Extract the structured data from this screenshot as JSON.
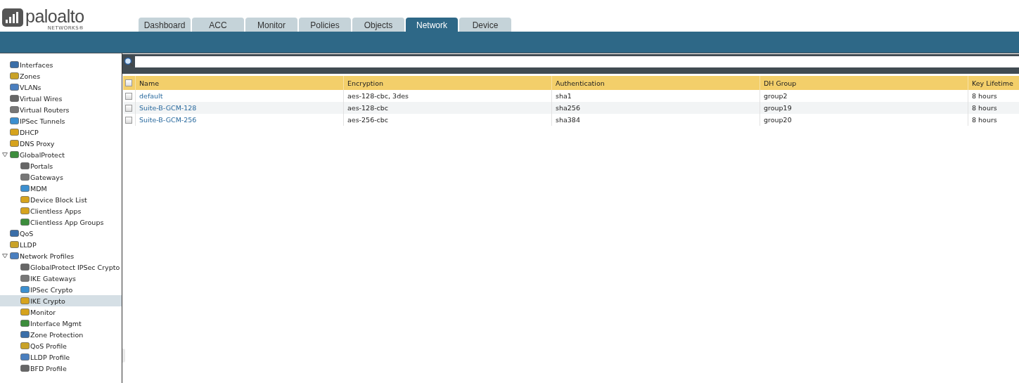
{
  "logo": {
    "name": "paloalto",
    "sub": "NETWORKS®"
  },
  "tabs": [
    {
      "label": "Dashboard",
      "selected": false
    },
    {
      "label": "ACC",
      "selected": false
    },
    {
      "label": "Monitor",
      "selected": false
    },
    {
      "label": "Policies",
      "selected": false
    },
    {
      "label": "Objects",
      "selected": false
    },
    {
      "label": "Network",
      "selected": true
    },
    {
      "label": "Device",
      "selected": false
    }
  ],
  "sidebar": {
    "items": [
      {
        "label": "Interfaces",
        "selected": false
      },
      {
        "label": "Zones",
        "selected": false
      },
      {
        "label": "VLANs",
        "selected": false
      },
      {
        "label": "Virtual Wires",
        "selected": false
      },
      {
        "label": "Virtual Routers",
        "selected": false
      },
      {
        "label": "IPSec Tunnels",
        "selected": false
      },
      {
        "label": "DHCP",
        "selected": false
      },
      {
        "label": "DNS Proxy",
        "selected": false
      },
      {
        "label": "GlobalProtect",
        "selected": false,
        "expanded": true,
        "children": [
          {
            "label": "Portals",
            "selected": false
          },
          {
            "label": "Gateways",
            "selected": false
          },
          {
            "label": "MDM",
            "selected": false
          },
          {
            "label": "Device Block List",
            "selected": false
          },
          {
            "label": "Clientless Apps",
            "selected": false
          },
          {
            "label": "Clientless App Groups",
            "selected": false
          }
        ]
      },
      {
        "label": "QoS",
        "selected": false
      },
      {
        "label": "LLDP",
        "selected": false
      },
      {
        "label": "Network Profiles",
        "selected": false,
        "expanded": true,
        "children": [
          {
            "label": "GlobalProtect IPSec Crypto",
            "selected": false
          },
          {
            "label": "IKE Gateways",
            "selected": false
          },
          {
            "label": "IPSec Crypto",
            "selected": false
          },
          {
            "label": "IKE Crypto",
            "selected": true
          },
          {
            "label": "Monitor",
            "selected": false
          },
          {
            "label": "Interface Mgmt",
            "selected": false
          },
          {
            "label": "Zone Protection",
            "selected": false
          },
          {
            "label": "QoS Profile",
            "selected": false
          },
          {
            "label": "LLDP Profile",
            "selected": false
          },
          {
            "label": "BFD Profile",
            "selected": false
          }
        ]
      }
    ]
  },
  "table": {
    "columns": [
      "Name",
      "Encryption",
      "Authentication",
      "DH Group",
      "Key Lifetime"
    ],
    "header_checked": false,
    "rows": [
      {
        "checked": false,
        "cells": [
          "default",
          "aes-128-cbc, 3des",
          "sha1",
          "group2",
          "8 hours"
        ]
      },
      {
        "checked": false,
        "cells": [
          "Suite-B-GCM-128",
          "aes-128-cbc",
          "sha256",
          "group19",
          "8 hours"
        ]
      },
      {
        "checked": false,
        "cells": [
          "Suite-B-GCM-256",
          "aes-256-cbc",
          "sha384",
          "group20",
          "8 hours"
        ]
      }
    ]
  }
}
